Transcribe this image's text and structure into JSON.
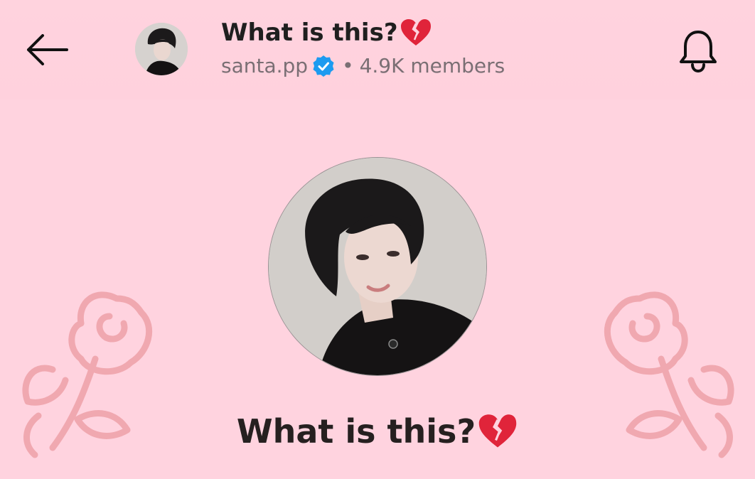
{
  "header": {
    "back_icon": "arrow-left-icon",
    "title": "What is this?",
    "title_emoji": "broken-heart-icon",
    "channel_name": "santa.pp",
    "verified_icon": "verified-badge-icon",
    "separator": "•",
    "members": "4.9K members",
    "bell_icon": "bell-icon"
  },
  "main": {
    "title": "What is this?",
    "title_emoji": "broken-heart-icon"
  },
  "colors": {
    "background": "#ffd3df",
    "verified": "#1d9bf0",
    "heart": "#e0243a",
    "rose_outline": "#f0a4ad"
  }
}
